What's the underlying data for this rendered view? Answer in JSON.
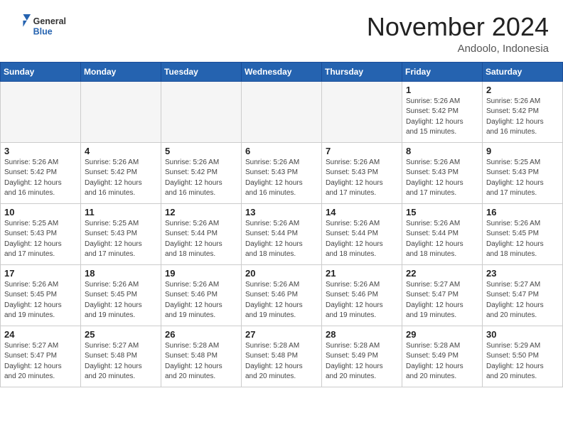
{
  "header": {
    "logo_general": "General",
    "logo_blue": "Blue",
    "month_title": "November 2024",
    "location": "Andoolo, Indonesia"
  },
  "days_of_week": [
    "Sunday",
    "Monday",
    "Tuesday",
    "Wednesday",
    "Thursday",
    "Friday",
    "Saturday"
  ],
  "weeks": [
    [
      {
        "day": "",
        "info": "",
        "empty": true
      },
      {
        "day": "",
        "info": "",
        "empty": true
      },
      {
        "day": "",
        "info": "",
        "empty": true
      },
      {
        "day": "",
        "info": "",
        "empty": true
      },
      {
        "day": "",
        "info": "",
        "empty": true
      },
      {
        "day": "1",
        "info": "Sunrise: 5:26 AM\nSunset: 5:42 PM\nDaylight: 12 hours\nand 15 minutes."
      },
      {
        "day": "2",
        "info": "Sunrise: 5:26 AM\nSunset: 5:42 PM\nDaylight: 12 hours\nand 16 minutes."
      }
    ],
    [
      {
        "day": "3",
        "info": "Sunrise: 5:26 AM\nSunset: 5:42 PM\nDaylight: 12 hours\nand 16 minutes."
      },
      {
        "day": "4",
        "info": "Sunrise: 5:26 AM\nSunset: 5:42 PM\nDaylight: 12 hours\nand 16 minutes."
      },
      {
        "day": "5",
        "info": "Sunrise: 5:26 AM\nSunset: 5:42 PM\nDaylight: 12 hours\nand 16 minutes."
      },
      {
        "day": "6",
        "info": "Sunrise: 5:26 AM\nSunset: 5:43 PM\nDaylight: 12 hours\nand 16 minutes."
      },
      {
        "day": "7",
        "info": "Sunrise: 5:26 AM\nSunset: 5:43 PM\nDaylight: 12 hours\nand 17 minutes."
      },
      {
        "day": "8",
        "info": "Sunrise: 5:26 AM\nSunset: 5:43 PM\nDaylight: 12 hours\nand 17 minutes."
      },
      {
        "day": "9",
        "info": "Sunrise: 5:25 AM\nSunset: 5:43 PM\nDaylight: 12 hours\nand 17 minutes."
      }
    ],
    [
      {
        "day": "10",
        "info": "Sunrise: 5:25 AM\nSunset: 5:43 PM\nDaylight: 12 hours\nand 17 minutes."
      },
      {
        "day": "11",
        "info": "Sunrise: 5:25 AM\nSunset: 5:43 PM\nDaylight: 12 hours\nand 17 minutes."
      },
      {
        "day": "12",
        "info": "Sunrise: 5:26 AM\nSunset: 5:44 PM\nDaylight: 12 hours\nand 18 minutes."
      },
      {
        "day": "13",
        "info": "Sunrise: 5:26 AM\nSunset: 5:44 PM\nDaylight: 12 hours\nand 18 minutes."
      },
      {
        "day": "14",
        "info": "Sunrise: 5:26 AM\nSunset: 5:44 PM\nDaylight: 12 hours\nand 18 minutes."
      },
      {
        "day": "15",
        "info": "Sunrise: 5:26 AM\nSunset: 5:44 PM\nDaylight: 12 hours\nand 18 minutes."
      },
      {
        "day": "16",
        "info": "Sunrise: 5:26 AM\nSunset: 5:45 PM\nDaylight: 12 hours\nand 18 minutes."
      }
    ],
    [
      {
        "day": "17",
        "info": "Sunrise: 5:26 AM\nSunset: 5:45 PM\nDaylight: 12 hours\nand 19 minutes."
      },
      {
        "day": "18",
        "info": "Sunrise: 5:26 AM\nSunset: 5:45 PM\nDaylight: 12 hours\nand 19 minutes."
      },
      {
        "day": "19",
        "info": "Sunrise: 5:26 AM\nSunset: 5:46 PM\nDaylight: 12 hours\nand 19 minutes."
      },
      {
        "day": "20",
        "info": "Sunrise: 5:26 AM\nSunset: 5:46 PM\nDaylight: 12 hours\nand 19 minutes."
      },
      {
        "day": "21",
        "info": "Sunrise: 5:26 AM\nSunset: 5:46 PM\nDaylight: 12 hours\nand 19 minutes."
      },
      {
        "day": "22",
        "info": "Sunrise: 5:27 AM\nSunset: 5:47 PM\nDaylight: 12 hours\nand 19 minutes."
      },
      {
        "day": "23",
        "info": "Sunrise: 5:27 AM\nSunset: 5:47 PM\nDaylight: 12 hours\nand 20 minutes."
      }
    ],
    [
      {
        "day": "24",
        "info": "Sunrise: 5:27 AM\nSunset: 5:47 PM\nDaylight: 12 hours\nand 20 minutes."
      },
      {
        "day": "25",
        "info": "Sunrise: 5:27 AM\nSunset: 5:48 PM\nDaylight: 12 hours\nand 20 minutes."
      },
      {
        "day": "26",
        "info": "Sunrise: 5:28 AM\nSunset: 5:48 PM\nDaylight: 12 hours\nand 20 minutes."
      },
      {
        "day": "27",
        "info": "Sunrise: 5:28 AM\nSunset: 5:48 PM\nDaylight: 12 hours\nand 20 minutes."
      },
      {
        "day": "28",
        "info": "Sunrise: 5:28 AM\nSunset: 5:49 PM\nDaylight: 12 hours\nand 20 minutes."
      },
      {
        "day": "29",
        "info": "Sunrise: 5:28 AM\nSunset: 5:49 PM\nDaylight: 12 hours\nand 20 minutes."
      },
      {
        "day": "30",
        "info": "Sunrise: 5:29 AM\nSunset: 5:50 PM\nDaylight: 12 hours\nand 20 minutes."
      }
    ]
  ]
}
